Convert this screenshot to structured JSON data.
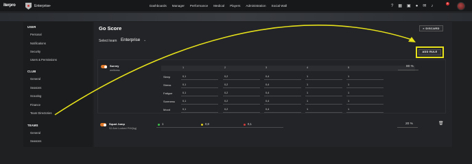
{
  "app": {
    "logo_text": "iterpro",
    "team": "Enterprise"
  },
  "nav": [
    "Dashboards",
    "Manager",
    "Performance",
    "Medical",
    "Players",
    "Administration",
    "Social Wall"
  ],
  "top_icons": [
    "help-icon",
    "calendar-icon",
    "cart-icon",
    "user-icon",
    "chat-icon",
    "bell-icon"
  ],
  "notification_count": "5",
  "sidebar": {
    "sections": [
      {
        "title": "USER",
        "items": [
          "Personal",
          "Notifications",
          "Security",
          "Users & Permissions"
        ]
      },
      {
        "title": "CLUB",
        "items": [
          "General",
          "Seasons",
          "Scouting",
          "Finance",
          "Team Directories"
        ]
      },
      {
        "title": "TEAMS",
        "items": [
          "General",
          "Seasons"
        ]
      }
    ]
  },
  "page": {
    "title": "Go Score",
    "discard_label": "DISCARD",
    "select_team_label": "Select team",
    "select_team_value": "Enterprise",
    "add_rule_label": "ADD RULE"
  },
  "rule1": {
    "name": "Survey",
    "subtitle": "wellness",
    "percent": "80 %",
    "columns": [
      "1",
      "2",
      "3",
      "4",
      "5"
    ],
    "rows": [
      {
        "label": "Sleep",
        "values": [
          "0,1",
          "0,2",
          "0,4",
          "1",
          "1"
        ]
      },
      {
        "label": "Stress",
        "values": [
          "0,1",
          "0,2",
          "0,4",
          "1",
          "1"
        ]
      },
      {
        "label": "Fatigue",
        "values": [
          "0,1",
          "0,2",
          "0,4",
          "1",
          "1"
        ]
      },
      {
        "label": "Soreness",
        "values": [
          "0,1",
          "0,2",
          "0,4",
          "1",
          "1"
        ]
      },
      {
        "label": "Mood",
        "values": [
          "0,1",
          "0,2",
          "0,4",
          "1",
          "1"
        ]
      }
    ]
  },
  "rule2": {
    "name": "Squat Jump",
    "subtitle": "SJ Arm Locked P/W(kg)",
    "percent": "20 %",
    "thresholds": [
      {
        "value": "1",
        "color": "#3cc24a"
      },
      {
        "value": "0,8",
        "color": "#e6d21a"
      },
      {
        "value": "0,1",
        "color": "#d83a3a"
      }
    ]
  },
  "colors": {
    "accent_toggle": "#e07a2a",
    "highlight": "#e6e11a"
  }
}
